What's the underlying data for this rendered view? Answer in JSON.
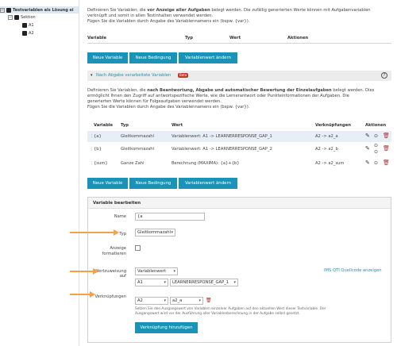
{
  "sidebar": {
    "items": [
      {
        "label": "Testvariablen als Lösung ei",
        "selected": true
      },
      {
        "label": "Sektion"
      },
      {
        "label": "A1"
      },
      {
        "label": "A2"
      }
    ]
  },
  "intro": {
    "line1_pre": "Definieren Sie Variablen, die ",
    "line1_bold": "vor Anzeige aller Aufgaben",
    "line1_post": " belegt werden. Die zufällig generierten Werte können mit Aufgabenvariablen",
    "line2": "verknüpft und somit in allen Testinhalten verwendet werden.",
    "line3": "Fügen Sie die Variablen durch Angabe des Variablennamens ein (bspw. {var})."
  },
  "table1": {
    "headers": [
      "Variable",
      "Typ",
      "Wert",
      "Aktionen"
    ]
  },
  "buttons1": [
    "Neue Variable",
    "Neue Bedingung",
    "Variablenwert ändern"
  ],
  "section2": {
    "title": "Nach Abgabe verarbeitete Variablen",
    "badge": "Beta",
    "help_icon": "help-circle-icon",
    "line1_pre": "Definieren Sie Variablen, die ",
    "line1_bold": "nach Beantwortung, Abgabe und automatischer Bewertung der Einzelaufgaben",
    "line1_post": " belegt werden. Dies",
    "line2": "ermöglicht Ihnen den Zugriff auf antwortspezifische Werte, wie die Lernerantwort oder Punkteinformationen der Aufgaben. Die",
    "line3": "generierten Werte können für Folgeaufgaben verwendet werden.",
    "line4": "Fügen Sie die Variablen durch Angabe des Variablennamens ein (bspw. {var})."
  },
  "table2": {
    "headers": [
      "Variable",
      "Typ",
      "Wert",
      "Verknüpfungen",
      "Aktionen"
    ],
    "rows": [
      {
        "variable": "{a}",
        "typ": "Gleitkommazahl",
        "wert": "Variablenwert: A1 -> LEARNERRESPONSE_GAP_1",
        "link": "A2 -> a2_a"
      },
      {
        "variable": "{b}",
        "typ": "Gleitkommazahl",
        "wert": "Variablenwert: A1 -> LEARNERRESPONSE_GAP_2",
        "link": "A2 -> a2_b"
      },
      {
        "variable": "{sum}",
        "typ": "Ganze Zahl",
        "wert": "Berechnung (MAXIMA): {a}+{b}",
        "link": "A2 -> a2_sum"
      }
    ]
  },
  "buttons2": [
    "Neue Variable",
    "Neue Bedingung",
    "Variablenwert ändern"
  ],
  "editor": {
    "title": "Variable bearbeiten",
    "name_label": "Name",
    "name_value": "{a",
    "typ_label": "Typ",
    "typ_value": "Gleitkommazahl",
    "formatted_label_1": "Anzeige",
    "formatted_label_2": "formatieren",
    "value_label": "Wertzuweisung auf",
    "value_type": "Variablenwert",
    "qti_link": "IMS QTI Quellcode anzeigen",
    "value_item": "A1",
    "value_var": "LEARNERRESPONSE_GAP_1",
    "links_label": "Verknüpfungen",
    "link_item": "A2",
    "link_var": "a2_a",
    "help1": "Setzen Sie den Ausgangswert von Variablen einzelner Aufgaben auf den aktuellen Wert dieser Testvariable. Der",
    "help2": "Ausgangswert wird vor der Ausführung aller Variablenberechnung in der Aufgabe selbst gesetzt.",
    "add_link_button": "Verknüpfung hinzufügen"
  },
  "colors": {
    "button": "#1993b7",
    "arrow": "#f5a04a",
    "badge": "#c0392b",
    "link": "#1993b7"
  }
}
